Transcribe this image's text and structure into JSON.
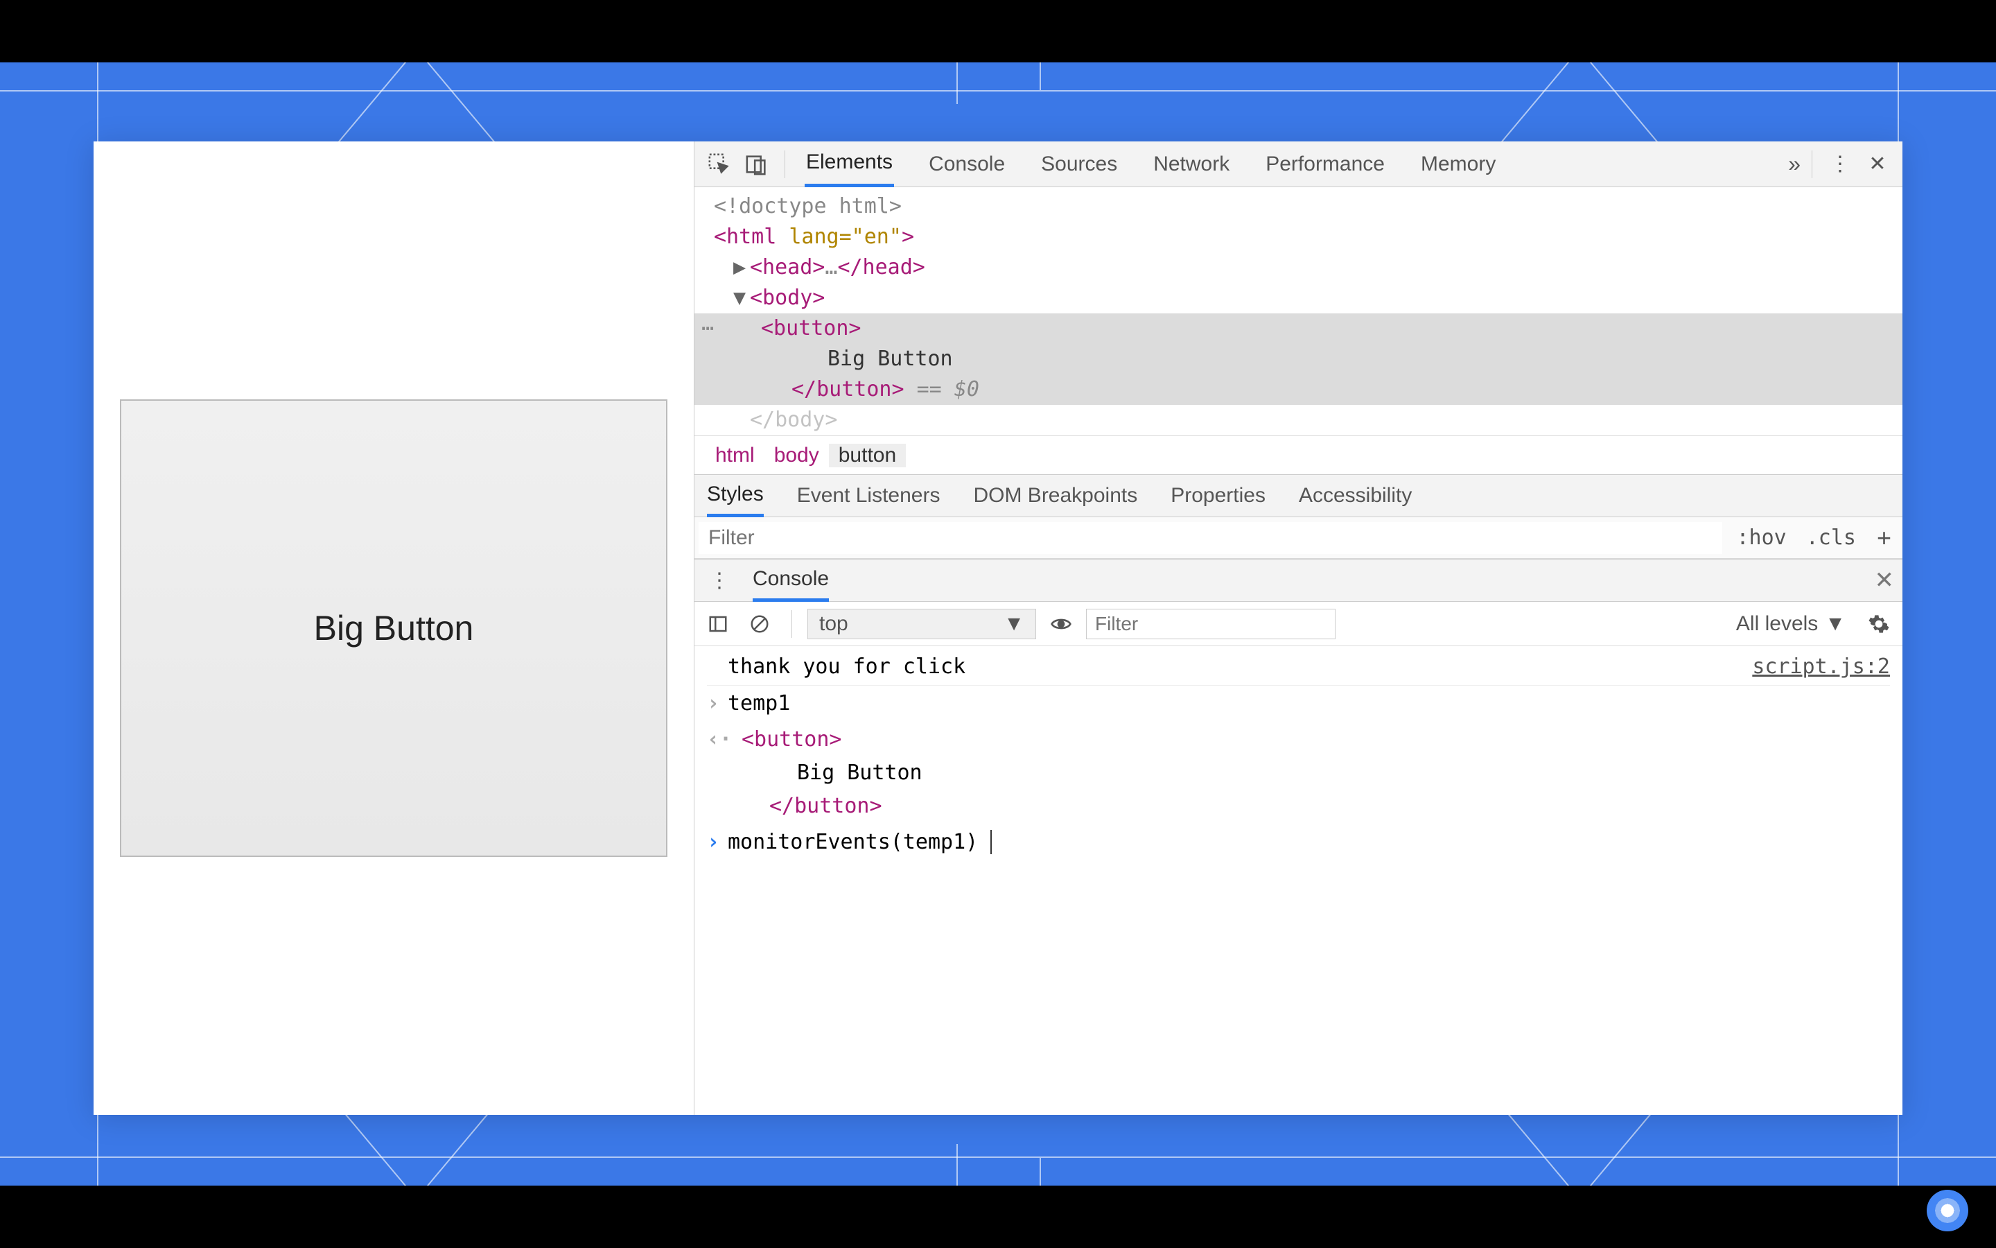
{
  "page": {
    "big_button_label": "Big Button"
  },
  "devtools": {
    "tabs": [
      "Elements",
      "Console",
      "Sources",
      "Network",
      "Performance",
      "Memory"
    ],
    "active_tab": "Elements",
    "dom": {
      "l0": "<!doctype html>",
      "l1_open": "<html",
      "l1_attr": " lang=\"en\"",
      "l1_close": ">",
      "l2_head_open": "<head>",
      "l2_head_ell": "…",
      "l2_head_close": "</head>",
      "l3_body": "<body>",
      "l4_btn_open": "<button>",
      "l4_btn_text": "Big Button",
      "l4_btn_close": "</button>",
      "l4_marker": " == $0",
      "l5_body_close": "</body>"
    },
    "breadcrumb": [
      "html",
      "body",
      "button"
    ],
    "styles_tabs": [
      "Styles",
      "Event Listeners",
      "DOM Breakpoints",
      "Properties",
      "Accessibility"
    ],
    "styles_filter_placeholder": "Filter",
    "hov": ":hov",
    "cls": ".cls",
    "drawer_title": "Console",
    "console_toolbar": {
      "context": "top",
      "filter_placeholder": "Filter",
      "levels": "All levels"
    },
    "console": {
      "log_msg": "thank you for click",
      "log_src": "script.js:2",
      "in1": "temp1",
      "out_btn_open": "<button>",
      "out_btn_text": "Big Button",
      "out_btn_close": "</button>",
      "in2": "monitorEvents(temp1)"
    }
  }
}
